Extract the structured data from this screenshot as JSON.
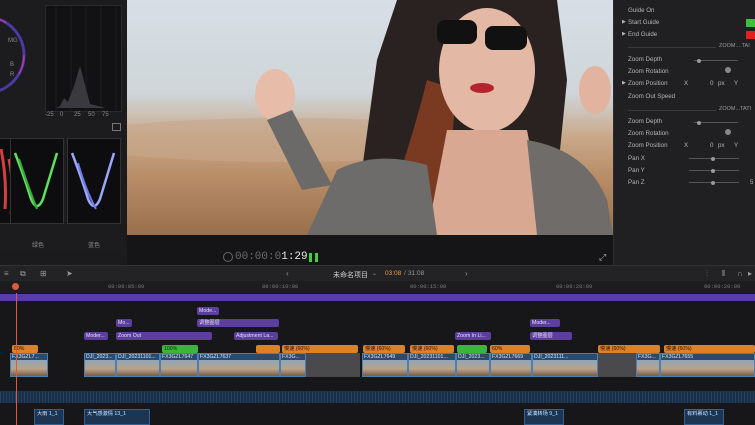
{
  "scopes": {
    "labels": [
      "-25",
      "0",
      "25",
      "50",
      "75"
    ],
    "wave_green_label": "绿色",
    "wave_blue_label": "蓝色",
    "side_marks": [
      "MG",
      "B",
      "R"
    ]
  },
  "viewer": {
    "timecode": "00:00:01:29",
    "timecode_dim": "00:00:0",
    "timecode_bright": "1:29"
  },
  "inspector": {
    "guide_on": "Guide On",
    "start_guide": "Start Guide",
    "end_guide": "End Guide",
    "section1": "ZOOM....TAI",
    "zoom_depth": "Zoom Depth",
    "zoom_rotation": "Zoom Rotation",
    "zoom_position": "Zoom Position",
    "x_label": "X",
    "x_value": "0",
    "px_unit": "px",
    "y_label": "Y",
    "zoom_out_speed": "Zoom Out Speed",
    "section2": "ZOOM...TATI",
    "zoom_depth_2": "Zoom Depth",
    "zoom_rotation_2": "Zoom Rotation",
    "zoom_position_2": "Zoom Position",
    "x_label_2": "X",
    "x_value_2": "0",
    "px_unit_2": "px",
    "y_label_2": "Y",
    "pan_x": "Pan X",
    "pan_y": "Pan Y",
    "pan_z": "Pan Z",
    "pan_z_value": "5",
    "colors": {
      "start_guide": "#3cc03c",
      "end_guide": "#e02020"
    }
  },
  "timeline": {
    "project_name": "未命名项目",
    "position": "03:08",
    "duration": "31:08",
    "ruler": [
      "00:00:00:00",
      "00:00:05:00",
      "00:00:10:00",
      "00:00:15:00",
      "00:00:20:00"
    ],
    "titles_row1": [
      "Mode..."
    ],
    "titles_row2": [
      "Mo...",
      "调整图层"
    ],
    "titles_row3": [
      "Moder...",
      "Zoom Out",
      "Adjustment La...",
      "Zoom In Li...",
      "调整图层"
    ],
    "titles_row3b": [
      "Moder..."
    ],
    "speed_tags": [
      "60%",
      "正常 (100%)",
      "慢速 (60%)",
      "慢速 (60%)",
      "慢速 (60%)",
      "100%",
      "60%",
      "慢速 (60%)",
      "慢速 (60%)"
    ],
    "clips": [
      "FX3GZL7...",
      "DJI_2023...",
      "DJI_20231101...",
      "FX3GZL7647",
      "FX3GZL7637",
      "FX3G...",
      "FX3GZL7649",
      "DJI_20231101...",
      "DJI_2023...",
      "FX3GZL7669",
      "DJI_2023111...",
      "FX3G...",
      "FX3GZL7655"
    ],
    "audio": [
      "大雨 1_1",
      "大气感激情 13_1",
      "紧凑转场 9_1",
      "有料裹动 1_1"
    ]
  }
}
